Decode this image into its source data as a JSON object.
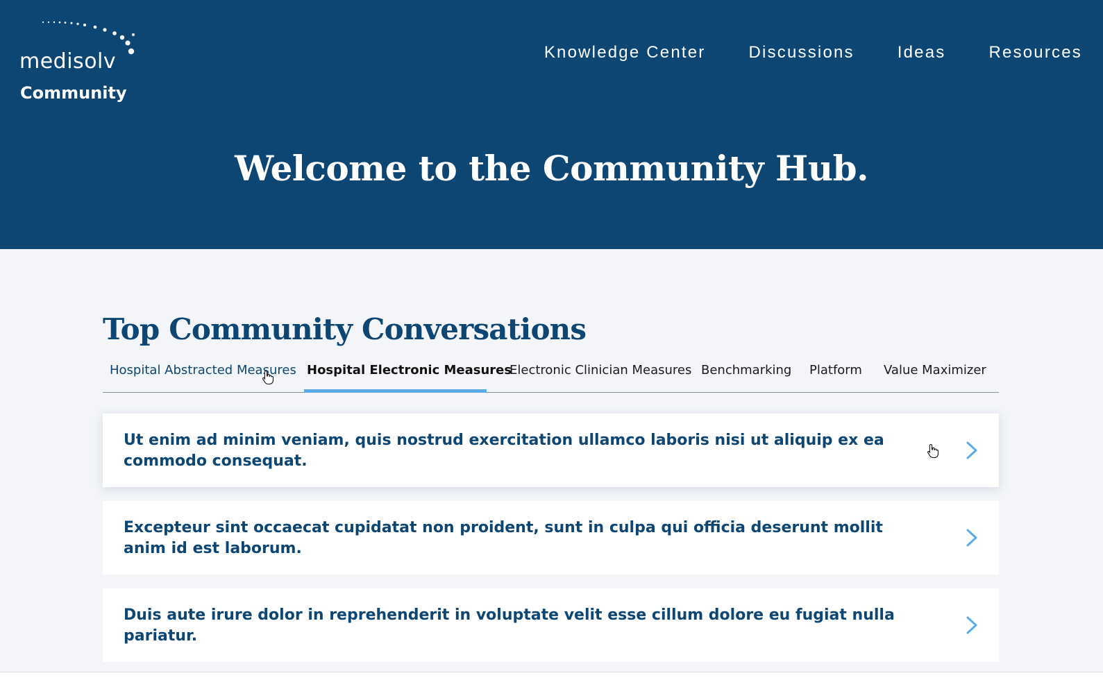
{
  "brand": {
    "name": "medisolv",
    "sub": "Community"
  },
  "nav": [
    {
      "label": "Knowledge Center"
    },
    {
      "label": "Discussions"
    },
    {
      "label": "Ideas"
    },
    {
      "label": "Resources"
    }
  ],
  "hero": {
    "title": "Welcome to the Community Hub."
  },
  "section": {
    "title": "Top Community Conversations"
  },
  "tabs": [
    {
      "label": "Hospital Abstracted Measures",
      "state": "hover"
    },
    {
      "label": "Hospital Electronic Measures",
      "state": "active"
    },
    {
      "label": "Electronic Clinician Measures",
      "state": "default"
    },
    {
      "label": "Benchmarking",
      "state": "default"
    },
    {
      "label": "Platform",
      "state": "default"
    },
    {
      "label": "Value Maximizer",
      "state": "default"
    }
  ],
  "conversations": [
    {
      "title": "Ut enim ad minim veniam, quis nostrud exercitation ullamco laboris nisi ut aliquip ex ea commodo consequat."
    },
    {
      "title": "Excepteur sint occaecat cupidatat non proident, sunt in culpa qui officia deserunt mollit anim id est laborum."
    },
    {
      "title": "Duis aute irure dolor in reprehenderit in voluptate velit esse cillum dolore eu fugiat nulla pariatur."
    }
  ],
  "icons": {
    "card_arrow": "chevron-right-icon",
    "cursor": "hand-pointer-icon"
  },
  "colors": {
    "header_bg": "#0d4673",
    "page_bg": "#f3f5f8",
    "accent": "#5aabe6",
    "text_primary": "#0d4673"
  }
}
